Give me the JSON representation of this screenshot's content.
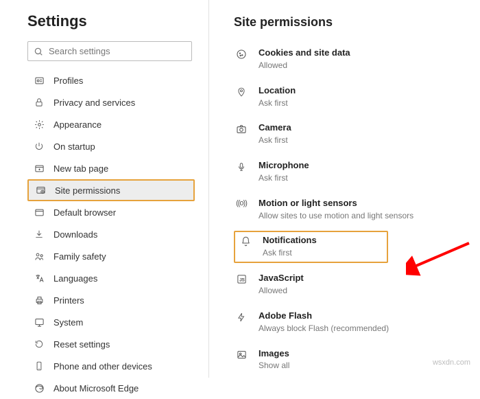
{
  "sidebar": {
    "title": "Settings",
    "search_placeholder": "Search settings",
    "items": [
      {
        "label": "Profiles"
      },
      {
        "label": "Privacy and services"
      },
      {
        "label": "Appearance"
      },
      {
        "label": "On startup"
      },
      {
        "label": "New tab page"
      },
      {
        "label": "Site permissions"
      },
      {
        "label": "Default browser"
      },
      {
        "label": "Downloads"
      },
      {
        "label": "Family safety"
      },
      {
        "label": "Languages"
      },
      {
        "label": "Printers"
      },
      {
        "label": "System"
      },
      {
        "label": "Reset settings"
      },
      {
        "label": "Phone and other devices"
      },
      {
        "label": "About Microsoft Edge"
      }
    ]
  },
  "main": {
    "title": "Site permissions",
    "items": [
      {
        "title": "Cookies and site data",
        "sub": "Allowed"
      },
      {
        "title": "Location",
        "sub": "Ask first"
      },
      {
        "title": "Camera",
        "sub": "Ask first"
      },
      {
        "title": "Microphone",
        "sub": "Ask first"
      },
      {
        "title": "Motion or light sensors",
        "sub": "Allow sites to use motion and light sensors"
      },
      {
        "title": "Notifications",
        "sub": "Ask first"
      },
      {
        "title": "JavaScript",
        "sub": "Allowed"
      },
      {
        "title": "Adobe Flash",
        "sub": "Always block Flash (recommended)"
      },
      {
        "title": "Images",
        "sub": "Show all"
      }
    ]
  },
  "watermark": "wsxdn.com"
}
